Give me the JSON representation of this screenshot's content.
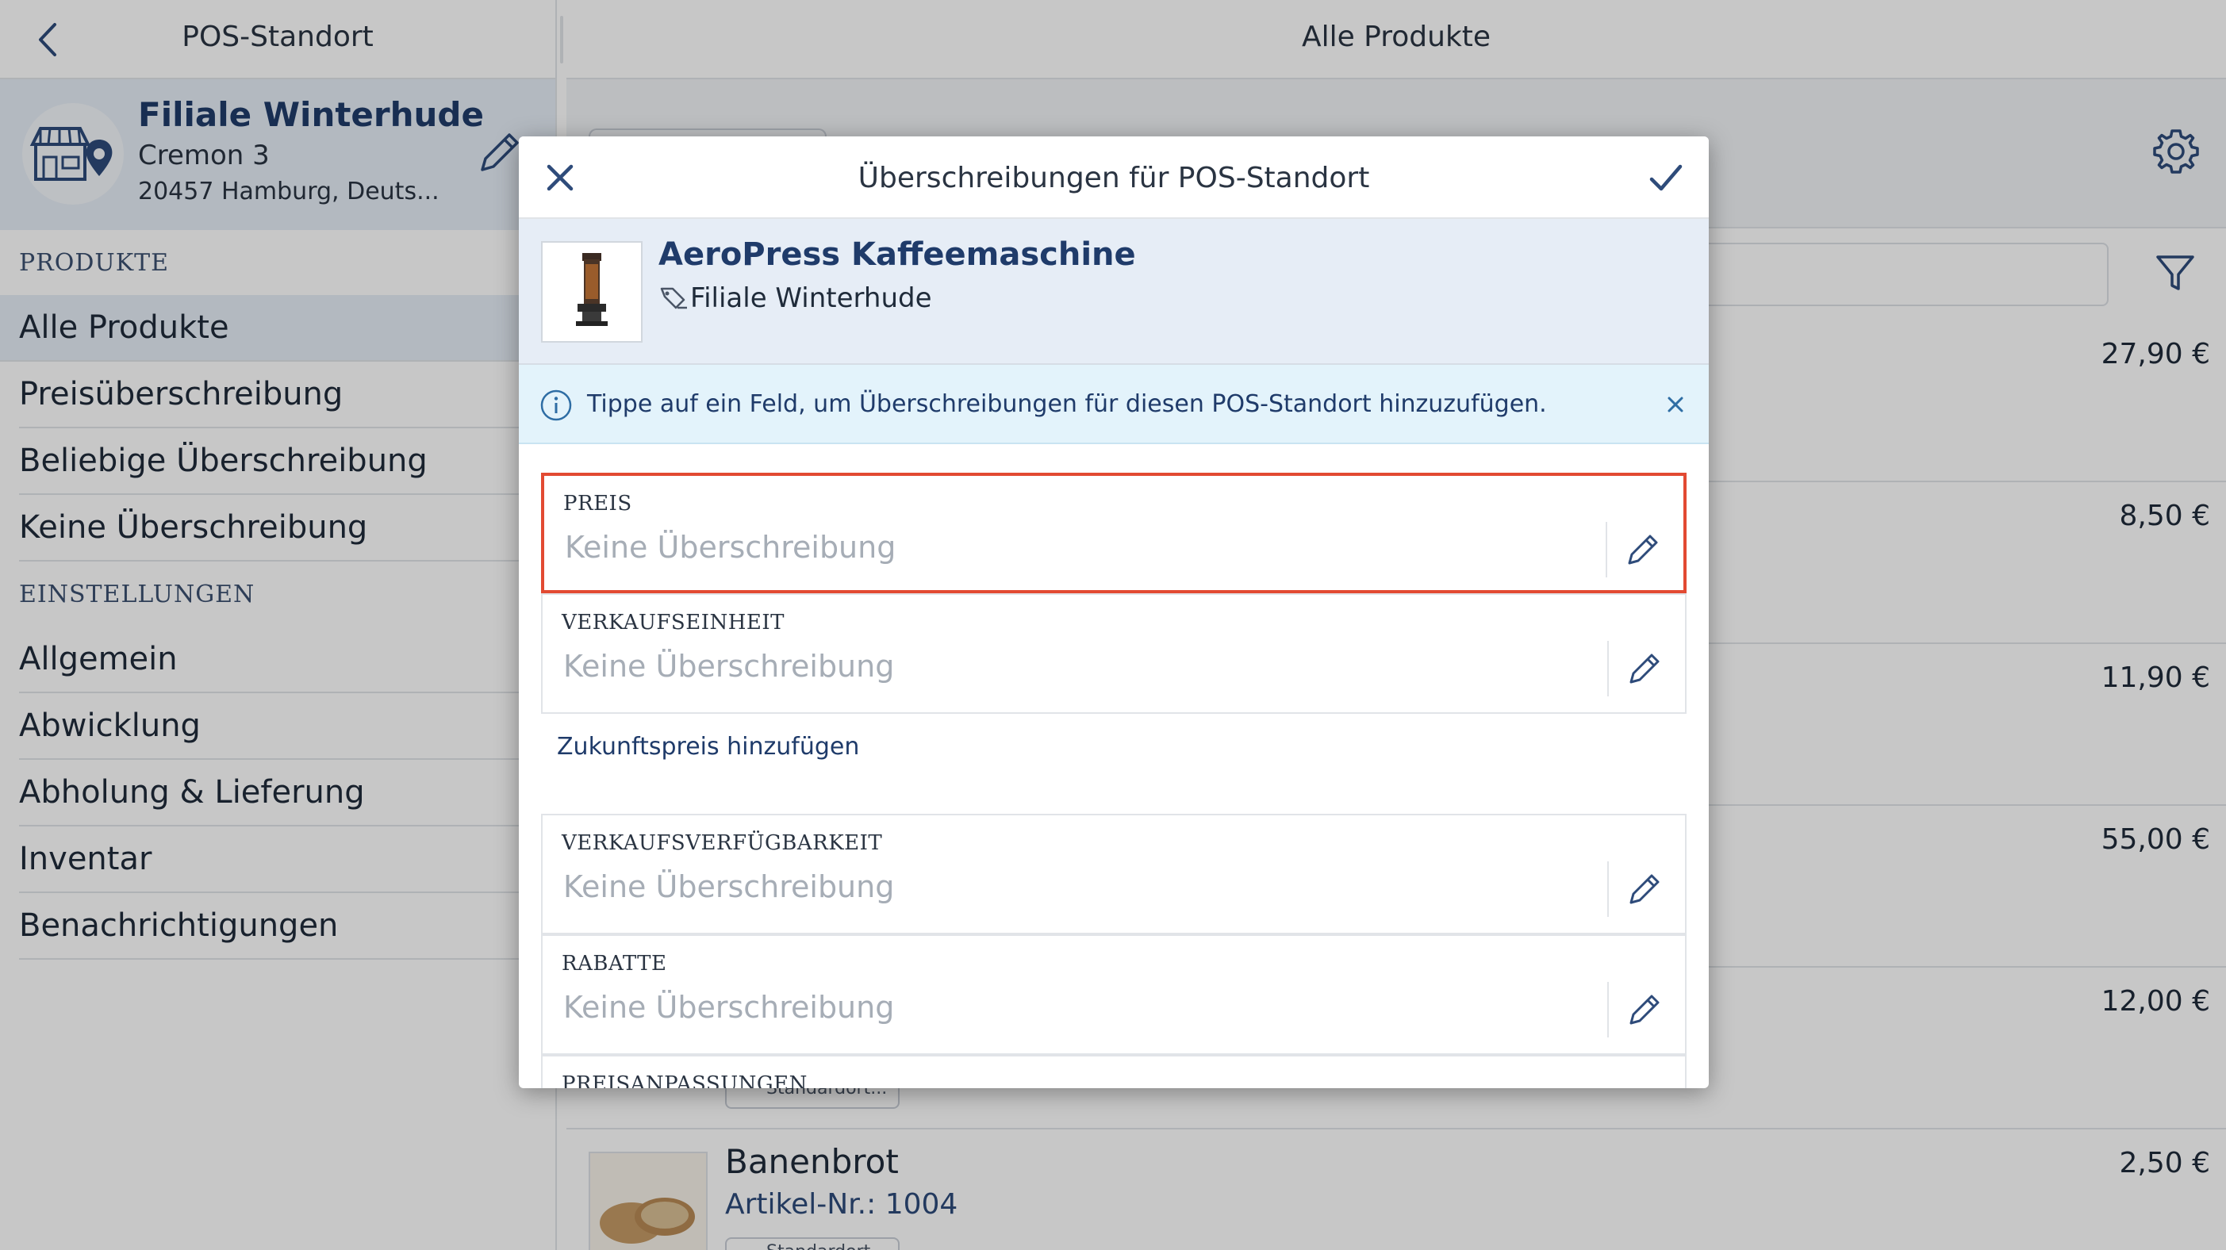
{
  "sidebar": {
    "title": "POS-Standort",
    "location": {
      "name": "Filiale Winterhude",
      "street": "Cremon 3",
      "city": "20457 Hamburg, Deuts..."
    },
    "sections": {
      "products_header": "PRODUKTE",
      "settings_header": "EINSTELLUNGEN"
    },
    "product_items": [
      "Alle Produkte",
      "Preisüberschreibung",
      "Beliebige Überschreibung",
      "Keine Überschreibung"
    ],
    "settings_items": [
      "Allgemein",
      "Abwicklung",
      "Abholung & Lieferung",
      "Inventar",
      "Benachrichtigungen"
    ]
  },
  "main": {
    "title": "Alle Produkte",
    "prices": [
      "27,90 €",
      "8,50 €",
      "11,90 €",
      "55,00 €",
      "12,00 €",
      "2,50 €"
    ],
    "visible_product": {
      "name": "Banenbrot",
      "sku": "Artikel-Nr.: 1004",
      "tag": "Standardort...",
      "tag_above": "Standardort..."
    }
  },
  "modal": {
    "title": "Überschreibungen für POS-Standort",
    "product_name": "AeroPress Kaffeemaschine",
    "product_location": "Filiale Winterhude",
    "info_text": "Tippe auf ein Feld, um Überschreibungen für diesen POS-Standort hinzuzufügen.",
    "fields": [
      {
        "label": "PREIS",
        "value": "Keine Überschreibung"
      },
      {
        "label": "VERKAUFSEINHEIT",
        "value": "Keine Überschreibung"
      },
      {
        "label": "VERKAUFSVERFÜGBARKEIT",
        "value": "Keine Überschreibung"
      },
      {
        "label": "RABATTE",
        "value": "Keine Überschreibung"
      },
      {
        "label": "PREISANPASSUNGEN",
        "value": ""
      }
    ],
    "future_price_link": "Zukunftspreis hinzufügen"
  },
  "colors": {
    "accent": "#1f3b6a",
    "highlight": "#e24a32",
    "info_bg": "#e3f3fb",
    "selected_bg": "#e6edf6"
  },
  "icons": [
    "chevron-left-icon",
    "store-location-icon",
    "pencil-icon",
    "gear-icon",
    "filter-icon",
    "close-icon",
    "checkmark-icon",
    "info-icon",
    "tag-icon"
  ]
}
